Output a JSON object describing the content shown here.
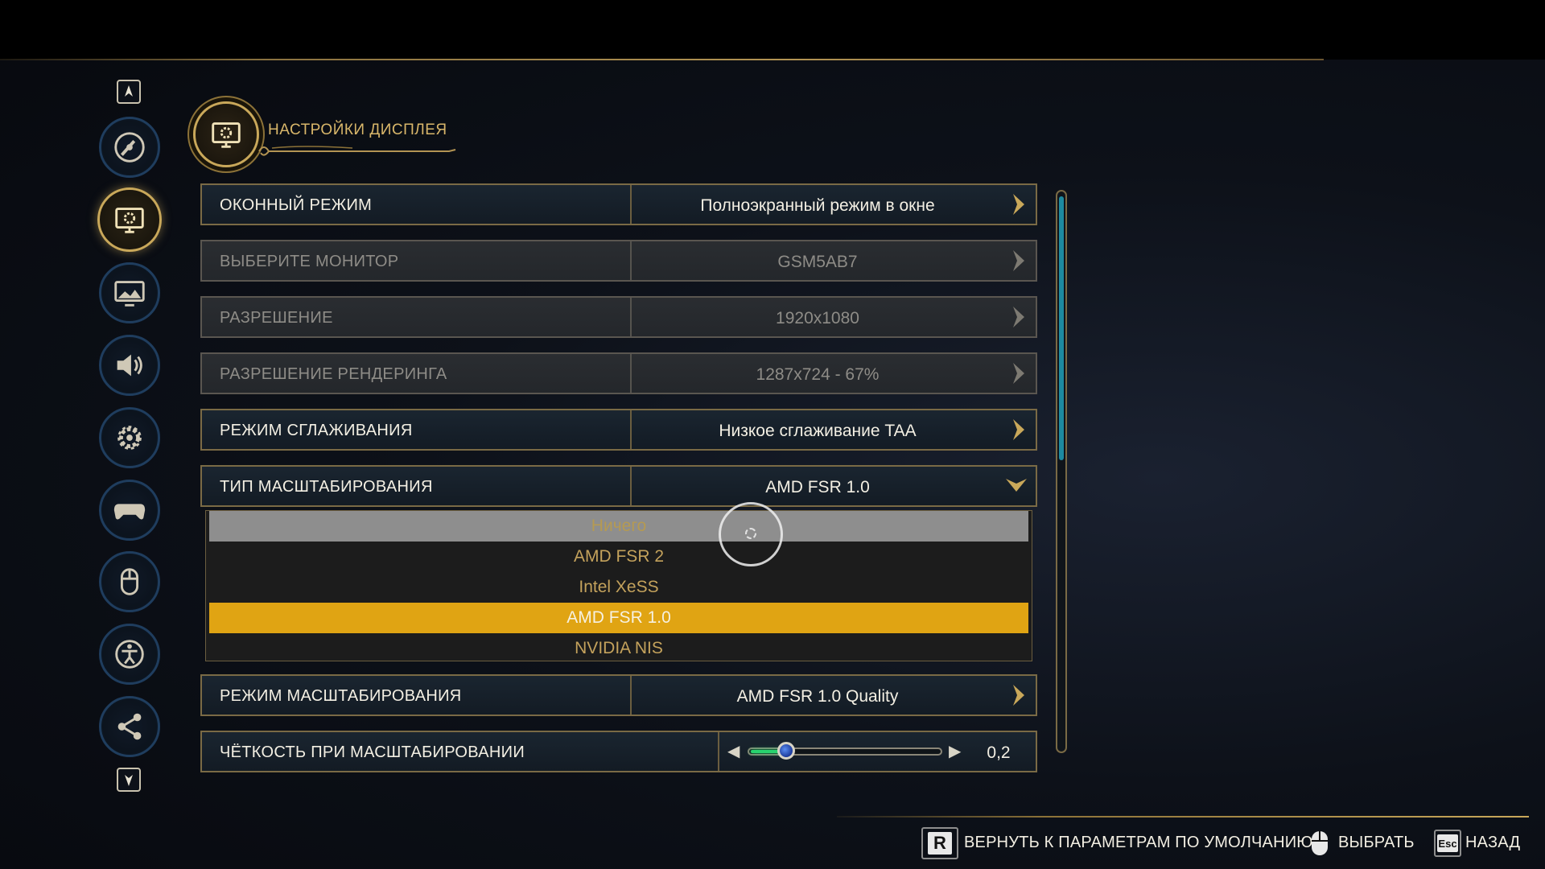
{
  "header": {
    "title": "НАСТРОЙКИ ДИСПЛЕЯ",
    "icon": "monitor-gear-icon"
  },
  "sidebar": {
    "items": [
      {
        "name": "disc-icon",
        "active": false
      },
      {
        "name": "monitor-gear-icon",
        "active": true
      },
      {
        "name": "image-quality-icon",
        "active": false
      },
      {
        "name": "speaker-icon",
        "active": false
      },
      {
        "name": "gear-icon",
        "active": false
      },
      {
        "name": "gamepad-icon",
        "active": false
      },
      {
        "name": "mouse-icon",
        "active": false
      },
      {
        "name": "accessibility-icon",
        "active": false
      },
      {
        "name": "share-nodes-icon",
        "active": false
      }
    ]
  },
  "settings": {
    "window_mode": {
      "label": "ОКОННЫЙ РЕЖИМ",
      "value": "Полноэкранный режим в окне"
    },
    "monitor": {
      "label": "ВЫБЕРИТЕ МОНИТОР",
      "value": "GSM5AB7"
    },
    "resolution": {
      "label": "РАЗРЕШЕНИЕ",
      "value": "1920x1080"
    },
    "render_resolution": {
      "label": "РАЗРЕШЕНИЕ РЕНДЕРИНГА",
      "value": "1287x724 - 67%"
    },
    "antialiasing": {
      "label": "РЕЖИМ СГЛАЖИВАНИЯ",
      "value": "Низкое сглаживание TAA"
    },
    "upscale_type": {
      "label": "ТИП МАСШТАБИРОВАНИЯ",
      "value": "AMD FSR 1.0"
    },
    "upscale_mode": {
      "label": "РЕЖИМ МАСШТАБИРОВАНИЯ",
      "value": "AMD FSR 1.0 Quality"
    },
    "upscale_sharpness": {
      "label": "ЧЁТКОСТЬ ПРИ МАСШТАБИРОВАНИИ",
      "value": "0,2",
      "fraction": 0.2
    }
  },
  "dropdown": {
    "options": [
      "Ничего",
      "AMD FSR 2",
      "Intel XeSS",
      "AMD FSR 1.0",
      "NVIDIA NIS"
    ],
    "hover_index": 0,
    "selected_index": 3
  },
  "scrollbar": {
    "thumb_fraction": 0.48
  },
  "footer": {
    "reset": {
      "key": "R",
      "label": "ВЕРНУТЬ К ПАРАМЕТРАМ ПО УМОЛЧАНИЮ"
    },
    "select": {
      "key_icon": "mouse-icon",
      "label": "ВЫБРАТЬ"
    },
    "back": {
      "key": "Esc",
      "label": "НАЗАД"
    }
  },
  "colors": {
    "accent_gold": "#c9a85a",
    "selected_option": "#e0a413",
    "slider_fill": "#28d26e",
    "scroll_thumb": "#1d8aa0"
  }
}
